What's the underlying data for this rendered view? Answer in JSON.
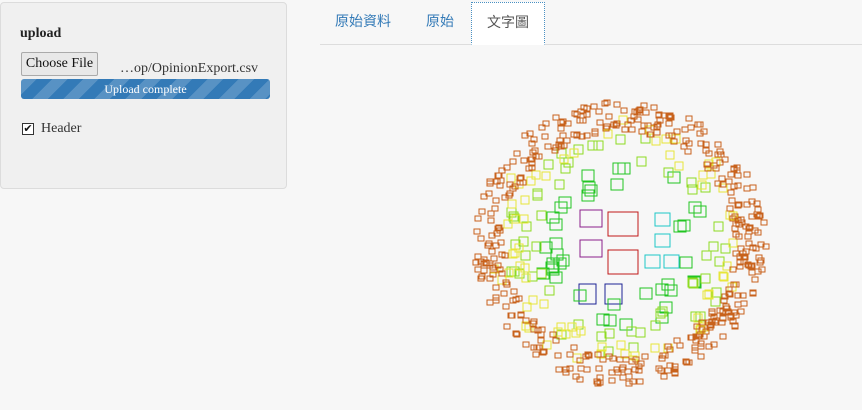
{
  "sidebar": {
    "title": "upload",
    "choose_button": "Choose File",
    "filename": "…op/OpinionExport.csv",
    "progress": {
      "label": "Upload complete",
      "percent": 100,
      "color": "#337ab7"
    },
    "header_checkbox": {
      "label": "Header",
      "checked": true
    }
  },
  "tabs": [
    {
      "label": "原始資料",
      "active": false
    },
    {
      "label": "原始",
      "active": false
    },
    {
      "label": "文字圖",
      "active": true
    }
  ],
  "wordcloud": {
    "palette": {
      "large_red": "#c0181a",
      "purple": "#8b1f8b",
      "navy": "#1c2394",
      "cyan": "#1ec7c7",
      "green": "#22c522",
      "lime": "#8edb22",
      "yellow": "#e7e63a",
      "orange": "#c8621c"
    }
  }
}
